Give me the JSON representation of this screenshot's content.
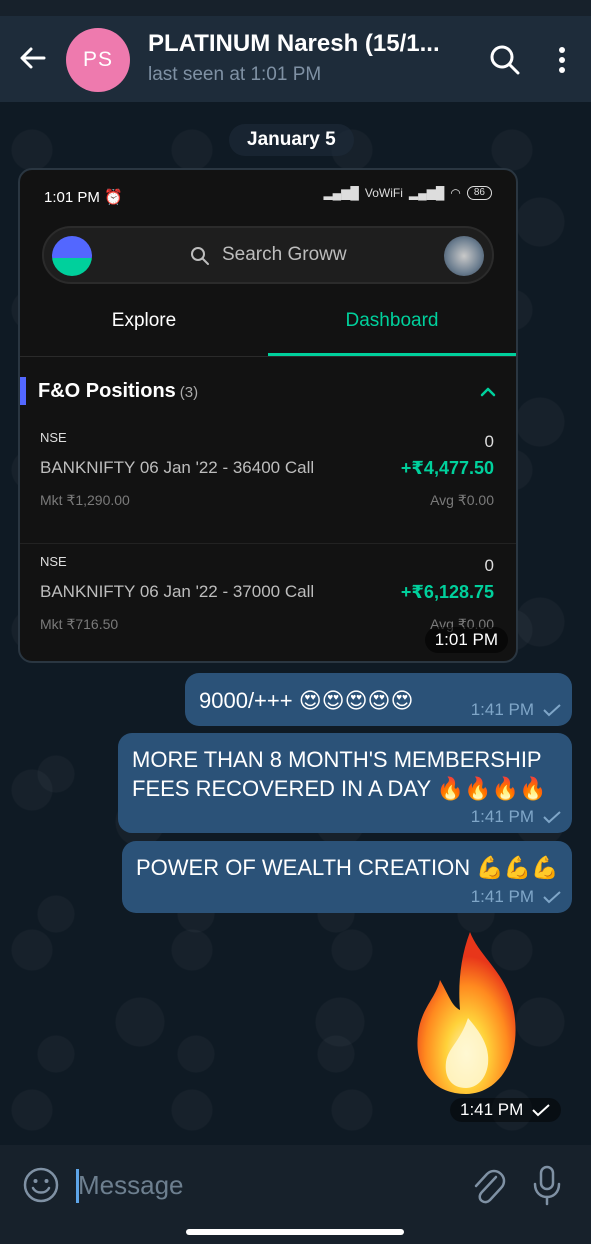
{
  "header": {
    "avatar_initials": "PS",
    "avatar_color": "#ee7aae",
    "title": "PLATINUM Naresh (15/1...",
    "subtitle": "last seen at 1:01 PM"
  },
  "chat": {
    "date_label": "January 5",
    "screenshot": {
      "status_time": "1:01 PM",
      "status_icons": "VoWiFi",
      "battery": "86",
      "search_placeholder": "Search Groww",
      "tabs": [
        "Explore",
        "Dashboard"
      ],
      "active_tab": "Dashboard",
      "section_title": "F&O Positions",
      "section_count": "(3)",
      "positions": [
        {
          "exchange": "NSE",
          "qty": "0",
          "name": "BANKNIFTY 06 Jan '22 - 36400 Call",
          "pnl": "+₹4,477.50",
          "mkt": "Mkt ₹1,290.00",
          "avg": "Avg ₹0.00"
        },
        {
          "exchange": "NSE",
          "qty": "0",
          "name": "BANKNIFTY 06 Jan '22 - 37000 Call",
          "pnl": "+₹6,128.75",
          "mkt": "Mkt ₹716.50",
          "avg": "Avg ₹0.00"
        }
      ],
      "time": "1:01 PM"
    },
    "messages": [
      {
        "text": "9000/+++ 😍😍😍😍😍",
        "time": "1:41 PM"
      },
      {
        "text": "MORE THAN 8 MONTH'S MEMBERSHIP FEES RECOVERED IN A DAY 🔥🔥🔥🔥",
        "time": "1:41 PM"
      },
      {
        "text": "POWER OF WEALTH CREATION 💪💪💪",
        "time": "1:41 PM"
      }
    ],
    "sticker": {
      "icon": "fire-sticker",
      "time": "1:41 PM"
    }
  },
  "input": {
    "placeholder": "Message"
  },
  "colors": {
    "header_bg": "#1e2c3a",
    "outgoing_bubble": "#2b5278",
    "groww_green": "#00d09c"
  }
}
